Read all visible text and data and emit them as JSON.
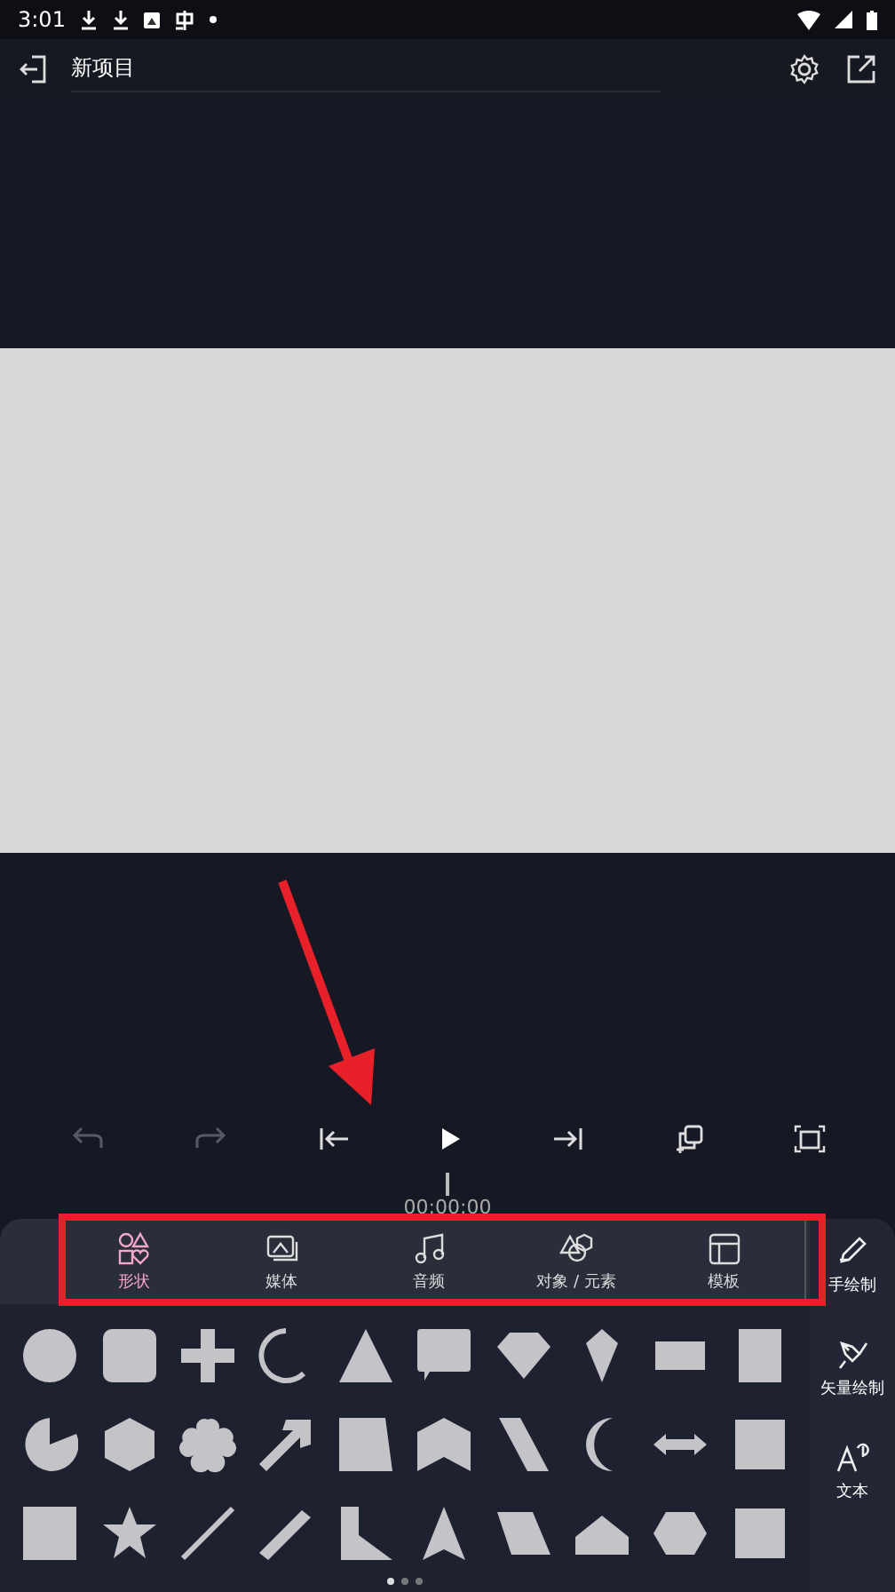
{
  "status_bar": {
    "time": "3:01"
  },
  "toolbar": {
    "title": "新项目"
  },
  "playback": {
    "undo_enabled": false,
    "redo_enabled": false,
    "timecode": "00:00:00"
  },
  "tabs": [
    {
      "label": "形状",
      "selected": true
    },
    {
      "label": "媒体",
      "selected": false
    },
    {
      "label": "音频",
      "selected": false
    },
    {
      "label": "对象 / 元素",
      "selected": false
    },
    {
      "label": "模板",
      "selected": false
    }
  ],
  "side_tools": [
    {
      "label": "手绘制"
    },
    {
      "label": "矢量绘制"
    },
    {
      "label": "文本"
    }
  ],
  "pager": [
    {
      "selected": true
    },
    {
      "selected": false
    },
    {
      "selected": false
    }
  ]
}
